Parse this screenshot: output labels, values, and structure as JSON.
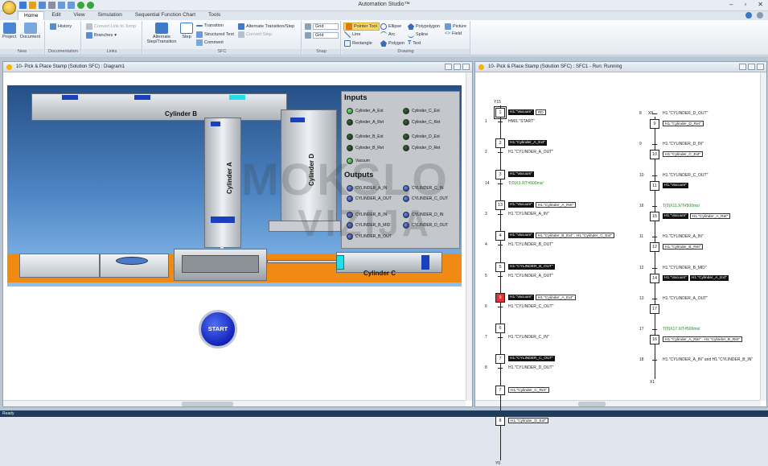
{
  "app": {
    "title": "Automation Studio™",
    "status": "Ready"
  },
  "tabs": [
    "Home",
    "Edit",
    "View",
    "Simulation",
    "Sequential Function Chart",
    "Tools"
  ],
  "ribbon": {
    "new": {
      "label": "New",
      "project": "Project",
      "document": "Document"
    },
    "documentation": {
      "label": "Documentation",
      "history": "History"
    },
    "links": {
      "label": "Links",
      "convert": "Convert Link to Jump",
      "branches": "Branches"
    },
    "sfc": {
      "label": "SFC",
      "alt_step": "Alternate Step/Transition",
      "step": "Step",
      "transition": "Transition",
      "structured_text": "Structured Text",
      "comment": "Comment",
      "alt_trans": "Alternate Transition/Step",
      "convert_step": "Convert Step"
    },
    "snap": {
      "label": "Snap",
      "grid1": "Grid",
      "grid2": "Grid"
    },
    "drawing": {
      "label": "Drawing",
      "pointer": "Pointer Tool",
      "line": "Line",
      "rectangle": "Rectangle",
      "ellipse": "Ellipse",
      "arc": "Arc",
      "polygon": "Polygon",
      "polypolygon": "Polypolygon",
      "spline": "Spline",
      "text": "Text",
      "picture": "Picture",
      "field": "Field"
    }
  },
  "left_pane": {
    "title": "10- Pick & Place Stamp (Solution SFC) : Diagram1"
  },
  "right_pane": {
    "title": "10- Pick & Place Stamp (Solution SFC) : SFC1 - Run: Running"
  },
  "diagram": {
    "cyl_b": "Cylinder B",
    "cyl_a": "Cylinder A",
    "cyl_d": "Cylinder D",
    "cyl_c": "Cylinder C",
    "inputs_title": "Inputs",
    "outputs_title": "Outputs",
    "start": "START",
    "inputs": [
      "Cylinder_A_Ext",
      "Cylinder_C_Ext",
      "Cylinder_A_Ret",
      "Cylinder_C_Ret",
      "Cylinder_B_Ext",
      "Cylinder_D_Ext",
      "Cylinder_B_Ret",
      "Cylinder_D_Ret",
      "Vacuum"
    ],
    "outputs": [
      "CYLINDER_A_IN",
      "CYLINDER_C_IN",
      "CYLINDER_A_OUT",
      "CYLINDER_C_OUT",
      "CYLINDER_B_IN",
      "CYLINDER_D_IN",
      "CYLINDER_B_MID",
      "CYLINDER_D_OUT",
      "CYLINDER_B_OUT"
    ]
  },
  "watermark": {
    "line1": "MOKSLO",
    "line2": "VIZIJA"
  },
  "sfc_left": {
    "top": "Y15",
    "bottom": "Y0",
    "steps": [
      {
        "n": "1",
        "acts": [
          {
            "t": "H1.\"Vacuum\"",
            "w": false
          },
          {
            "t": "RD",
            "w": true
          }
        ]
      },
      {
        "n": "2",
        "acts": [
          {
            "t": "H1.\"Cylinder_A_Ext\"",
            "w": false
          }
        ]
      },
      {
        "n": "3",
        "acts": [
          {
            "t": "H1.\"Vacuum\"",
            "w": false
          }
        ]
      },
      {
        "n": "13",
        "acts": [
          {
            "t": "H1.\"Vacuum\"",
            "w": false
          },
          {
            "t": "H1.\"Cylinder_A_Ret\"",
            "w": true
          }
        ]
      },
      {
        "n": "4",
        "acts": [
          {
            "t": "H1.\"Vacuum\"",
            "w": false
          },
          {
            "t": "H1.\"Cylinder_B_Ext\" . H1.\"Cylinder_C_Ext\"",
            "w": true
          }
        ]
      },
      {
        "n": "5",
        "acts": [
          {
            "t": "H1.\"CYLINDER_B_OUT\"",
            "w": false
          }
        ]
      },
      {
        "n": "9",
        "acts": [
          {
            "t": "H1.\"Vacuum\"",
            "w": false
          },
          {
            "t": "H1.\"Cylinder_A_Ext\"",
            "w": true
          }
        ]
      },
      {
        "n": "6",
        "acts": []
      },
      {
        "n": "7",
        "acts": [
          {
            "t": "H1.\"CYLINDER_C_OUT\"",
            "w": false
          }
        ]
      },
      {
        "n": "7",
        "acts": [
          {
            "t": "H1.\"Cylinder_C_Ret\"",
            "w": true
          }
        ]
      },
      {
        "n": "8",
        "acts": [
          {
            "t": "H1.\"Cylinder_D_Ext\"",
            "w": true
          }
        ]
      }
    ],
    "trans": [
      {
        "n": "1",
        "c": "HMI1.\"START\"",
        "g": false
      },
      {
        "n": "2",
        "c": "H1.\"CYLINDER_A_OUT\"",
        "g": false
      },
      {
        "n": "14",
        "c": "T(0)X3.X/T#500ms/",
        "g": true
      },
      {
        "n": "3",
        "c": "H1.\"CYLINDER_A_IN\"",
        "g": false
      },
      {
        "n": "4",
        "c": "H1.\"CYLINDER_B_OUT\"",
        "g": false
      },
      {
        "n": "5",
        "c": "H1.\"CYLINDER_A_OUT\"",
        "g": false
      },
      {
        "n": "6",
        "c": "H1.\"CYLINDER_C_OUT\"",
        "g": false
      },
      {
        "n": "7",
        "c": "H1.\"CYLINDER_C_IN\"",
        "g": false
      },
      {
        "n": "8",
        "c": "H1.\"CYLINDER_D_OUT\"",
        "g": false
      }
    ]
  },
  "sfc_right": {
    "top": "X8",
    "bottom": "X1",
    "steps": [
      {
        "n": "9",
        "acts": [
          {
            "t": "H1.\"Cylinder_D_Ret\"",
            "w": true
          }
        ]
      },
      {
        "n": "10",
        "acts": [
          {
            "t": "H1.\"Cylinder_C_Ext\"",
            "w": true
          }
        ]
      },
      {
        "n": "11",
        "acts": [
          {
            "t": "H1.\"Vacuum\"",
            "w": false
          }
        ]
      },
      {
        "n": "15",
        "acts": [
          {
            "t": "H1.\"Vacuum\"",
            "w": false
          },
          {
            "t": "H1.\"Cylinder_A_Ret\"",
            "w": true
          }
        ]
      },
      {
        "n": "12",
        "acts": [
          {
            "t": "H1.\"Cylinder_B_Ret\"",
            "w": true
          }
        ]
      },
      {
        "n": "14",
        "acts": [
          {
            "t": "H1.\"Vacuum\"",
            "w": false
          },
          {
            "t": "H1.\"Cylinder_A_Ext\"",
            "w": false
          }
        ]
      },
      {
        "n": "17",
        "acts": []
      },
      {
        "n": "16",
        "acts": [
          {
            "t": "H1.\"Cylinder_A_Ret\" . H1.\"Cylinder_B_Ret\"",
            "w": true
          }
        ]
      }
    ],
    "trans": [
      {
        "n": "8",
        "c": "H1.\"CYLINDER_D_OUT\"",
        "g": false
      },
      {
        "n": "9",
        "c": "H1.\"CYLINDER_D_IN\"",
        "g": false
      },
      {
        "n": "10",
        "c": "H1.\"CYLINDER_C_OUT\"",
        "g": false
      },
      {
        "n": "16",
        "c": "T(0)X11.X/T#500ms/",
        "g": true
      },
      {
        "n": "11",
        "c": "H1.\"CYLINDER_A_IN\"",
        "g": false
      },
      {
        "n": "12",
        "c": "H1.\"CYLINDER_B_MID\"",
        "g": false
      },
      {
        "n": "13",
        "c": "H1.\"CYLINDER_A_OUT\"",
        "g": false
      },
      {
        "n": "17",
        "c": "T(0)X17.X/T#500ms/",
        "g": true
      },
      {
        "n": "18",
        "c": "H1.\"CYLINDER_A_IN\" and H1.\"CYLINDER_B_IN\"",
        "g": false
      }
    ]
  },
  "colors": {
    "accent": "#2a5fa8",
    "floor": "#f08a12",
    "active_step": "#e53030"
  }
}
